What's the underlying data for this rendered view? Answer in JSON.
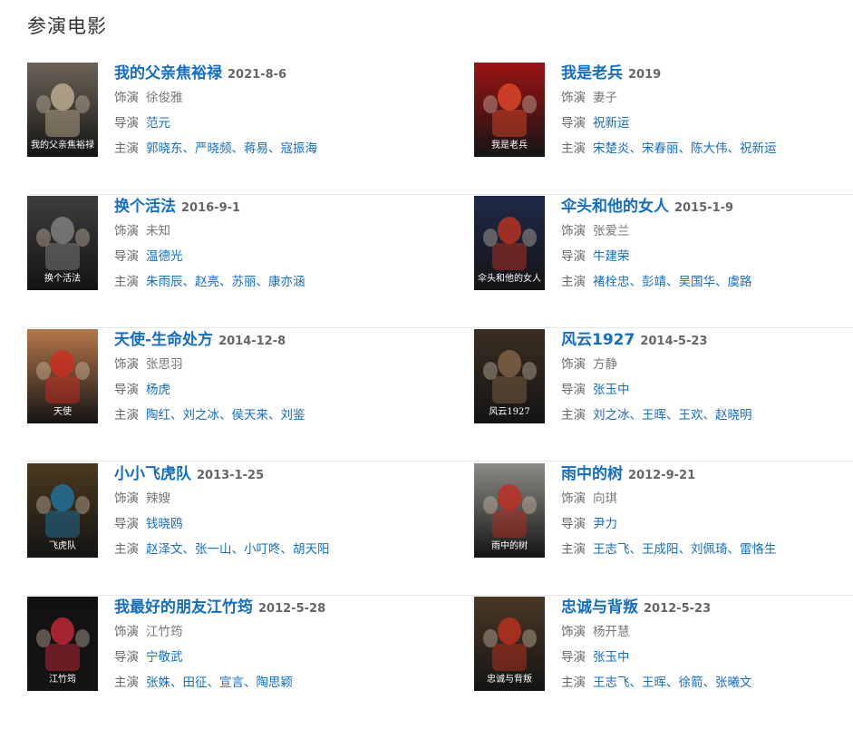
{
  "section_title": "参演电影",
  "labels": {
    "role": "饰演",
    "director": "导演",
    "cast": "主演"
  },
  "movies": [
    {
      "title": "我的父亲焦裕禄",
      "date": "2021-8-6",
      "role": "徐俊雅",
      "director": [
        "范元"
      ],
      "cast": [
        "郭晓东",
        "严晓频",
        "蒋易",
        "寇振海"
      ],
      "poster": {
        "bg": "#6b6357",
        "accent": "#c9b99a",
        "text": "我的父亲焦裕禄"
      }
    },
    {
      "title": "我是老兵",
      "date": "2019",
      "role": "妻子",
      "director": [
        "祝新运"
      ],
      "cast": [
        "宋楚炎",
        "宋春丽",
        "陈大伟",
        "祝新运"
      ],
      "poster": {
        "bg": "#9c1414",
        "accent": "#e84b2a",
        "text": "我是老兵"
      }
    },
    {
      "title": "换个活法",
      "date": "2016-9-1",
      "role": "未知",
      "director": [
        "温德光"
      ],
      "cast": [
        "朱雨辰",
        "赵亮",
        "苏丽",
        "康亦涵"
      ],
      "poster": {
        "bg": "#3d3d3d",
        "accent": "#8a8a8a",
        "text": "换个活法"
      }
    },
    {
      "title": "伞头和他的女人",
      "date": "2015-1-9",
      "role": "张爱兰",
      "director": [
        "牛建荣"
      ],
      "cast": [
        "褚栓忠",
        "彭靖",
        "吴国华",
        "虞路"
      ],
      "poster": {
        "bg": "#1f2a4a",
        "accent": "#c9341f",
        "text": "伞头和他的女人"
      }
    },
    {
      "title": "天使-生命处方",
      "date": "2014-12-8",
      "role": "张思羽",
      "director": [
        "杨虎"
      ],
      "cast": [
        "陶红",
        "刘之冰",
        "侯天来",
        "刘鉴"
      ],
      "poster": {
        "bg": "#b5774a",
        "accent": "#d42a1e",
        "text": "天使"
      }
    },
    {
      "title": "风云1927",
      "date": "2014-5-23",
      "role": "方静",
      "director": [
        "张玉中"
      ],
      "cast": [
        "刘之冰",
        "王晖",
        "王欢",
        "赵晓明"
      ],
      "poster": {
        "bg": "#3a2e22",
        "accent": "#8a6a4a",
        "text": "风云1927"
      }
    },
    {
      "title": "小小飞虎队",
      "date": "2013-1-25",
      "role": "辣嫂",
      "director": [
        "钱晓鸥"
      ],
      "cast": [
        "赵泽文",
        "张一山",
        "小叮咚",
        "胡天阳"
      ],
      "poster": {
        "bg": "#4a3a1e",
        "accent": "#1e7aa8",
        "text": "飞虎队"
      }
    },
    {
      "title": "雨中的树",
      "date": "2012-9-21",
      "role": "向琪",
      "director": [
        "尹力"
      ],
      "cast": [
        "王志飞",
        "王成阳",
        "刘佩琦",
        "雷恪生"
      ],
      "poster": {
        "bg": "#8c8c86",
        "accent": "#c8281e",
        "text": "雨中的树"
      }
    },
    {
      "title": "我最好的朋友江竹筠",
      "date": "2012-5-28",
      "role": "江竹筠",
      "director": [
        "宁敬武"
      ],
      "cast": [
        "张姝",
        "田征",
        "宣言",
        "陶思颖"
      ],
      "poster": {
        "bg": "#111111",
        "accent": "#d42a3a",
        "text": "江竹筠"
      }
    },
    {
      "title": "忠诚与背叛",
      "date": "2012-5-23",
      "role": "杨开慧",
      "director": [
        "张玉中"
      ],
      "cast": [
        "王志飞",
        "王晖",
        "徐箭",
        "张曦文"
      ],
      "poster": {
        "bg": "#4a3826",
        "accent": "#c83220",
        "text": "忠诚与背叛"
      }
    }
  ]
}
